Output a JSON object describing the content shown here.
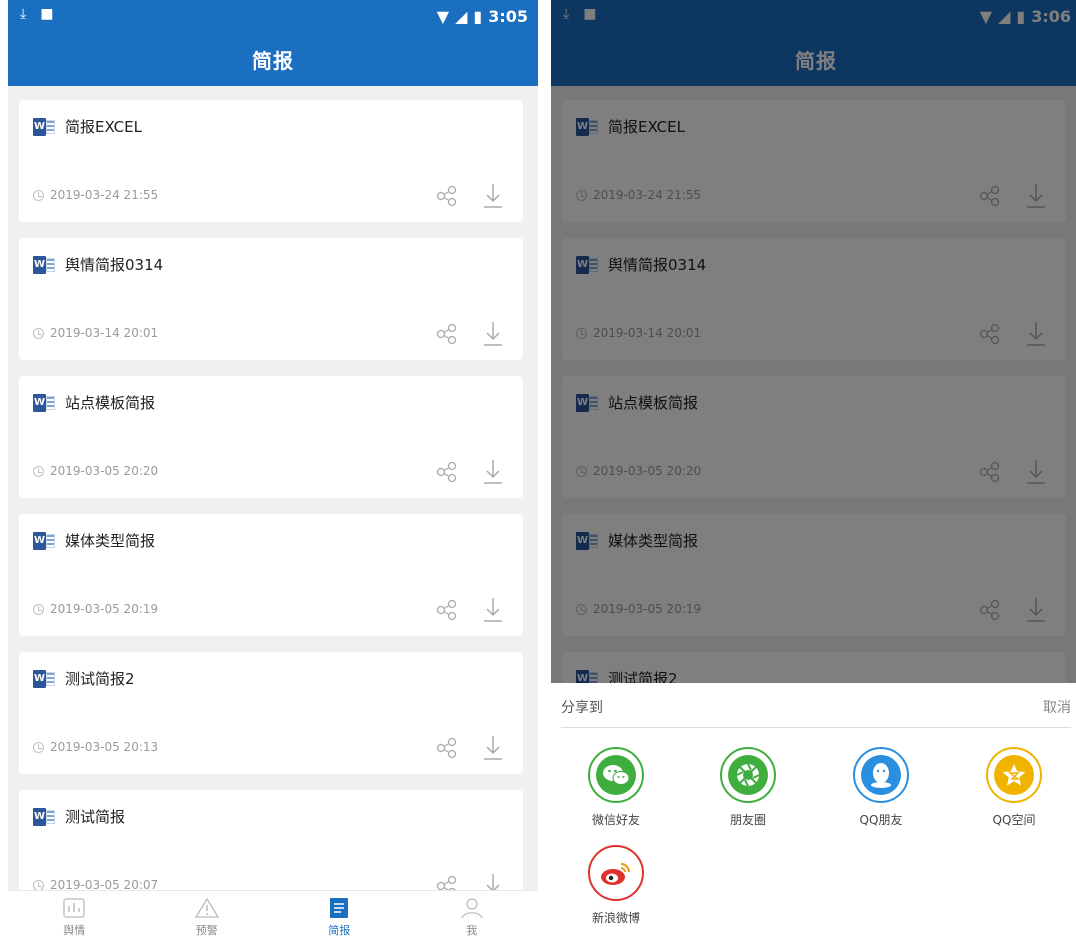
{
  "status_left": {
    "time": "3:05"
  },
  "status_right": {
    "time": "3:06"
  },
  "page_title": "简报",
  "reports": [
    {
      "name": "简报EXCEL",
      "date": "2019-03-24 21:55"
    },
    {
      "name": "舆情简报0314",
      "date": "2019-03-14 20:01"
    },
    {
      "name": "站点模板简报",
      "date": "2019-03-05 20:20"
    },
    {
      "name": "媒体类型简报",
      "date": "2019-03-05 20:19"
    },
    {
      "name": "测试简报2",
      "date": "2019-03-05 20:13"
    },
    {
      "name": "测试简报",
      "date": "2019-03-05 20:07"
    }
  ],
  "word_icon_letter": "W",
  "tabs": [
    {
      "label": "舆情",
      "icon": "chart-icon"
    },
    {
      "label": "预警",
      "icon": "warning-icon"
    },
    {
      "label": "简报",
      "icon": "report-icon",
      "active": true
    },
    {
      "label": "我",
      "icon": "user-icon"
    }
  ],
  "share_sheet": {
    "title": "分享到",
    "cancel": "取消",
    "targets": [
      {
        "label": "微信好友",
        "icon": "wechat-icon",
        "color": "#3fae3f"
      },
      {
        "label": "朋友圈",
        "icon": "moments-icon",
        "color": "#3fae3f"
      },
      {
        "label": "QQ朋友",
        "icon": "qq-icon",
        "color": "#2a8fe0"
      },
      {
        "label": "QQ空间",
        "icon": "qzone-icon",
        "color": "#f0b400"
      },
      {
        "label": "新浪微博",
        "icon": "weibo-icon",
        "color": "#e0322c"
      }
    ]
  },
  "colors": {
    "brand": "#1a6fc0",
    "word": "#2b579a"
  }
}
